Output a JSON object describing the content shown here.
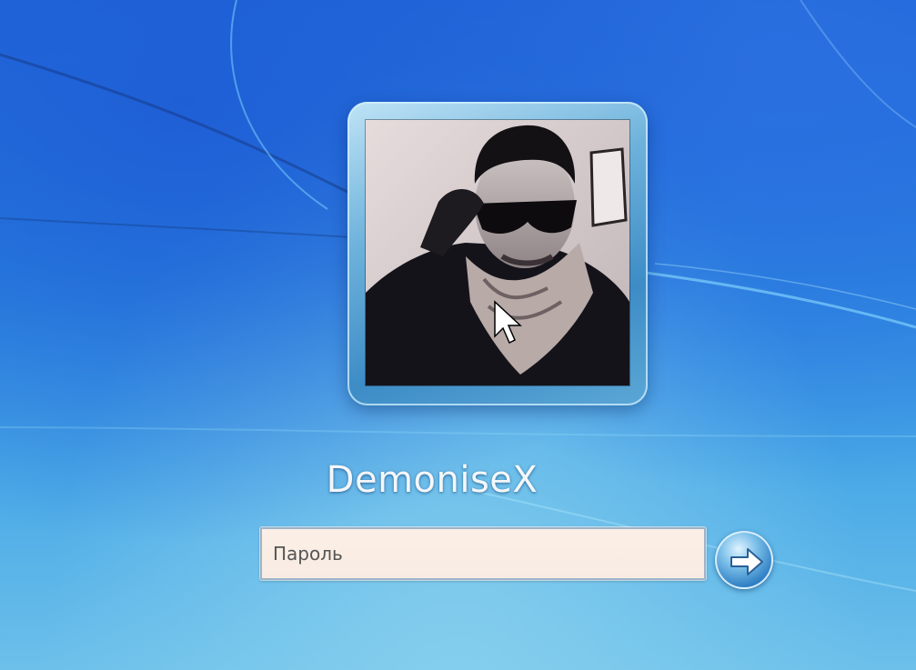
{
  "user": {
    "name": "DemoniseX"
  },
  "login": {
    "password_placeholder": "Пароль",
    "password_value": ""
  },
  "icons": {
    "submit": "arrow-right-icon",
    "avatar": "user-photo"
  },
  "colors": {
    "background_top": "#1e64d8",
    "background_bottom": "#6cc0ea",
    "tile_frame": "#5ba7d6",
    "field_bg": "#f8ece4",
    "username_text": "#f4f7fa"
  }
}
